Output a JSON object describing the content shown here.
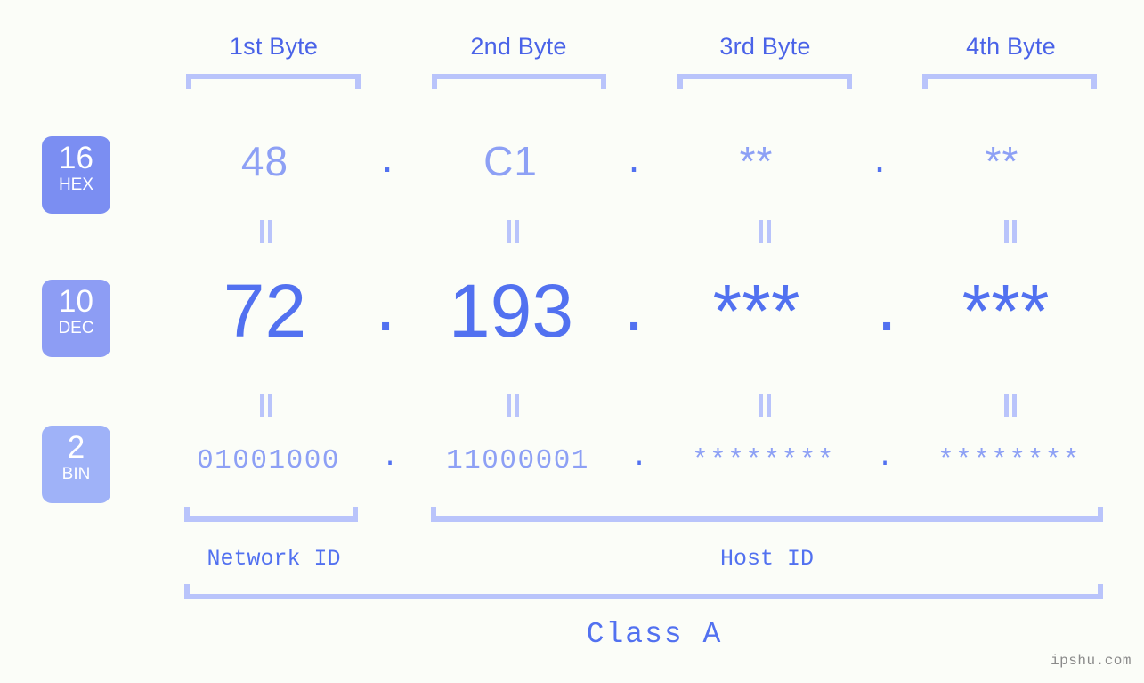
{
  "watermark": "ipshu.com",
  "colors": {
    "background": "#fbfdf8",
    "strong": "#5271f0",
    "mid": "#8da0f5",
    "light": "#b9c4fb",
    "header_text": "#4a63e8",
    "badge_hex": "#7b8ef2",
    "badge_dec": "#8d9df4",
    "badge_bin": "#9fb2f8",
    "watermark": "#8a8a8a"
  },
  "byte_headers": [
    {
      "label": "1st Byte"
    },
    {
      "label": "2nd Byte"
    },
    {
      "label": "3rd Byte"
    },
    {
      "label": "4th Byte"
    }
  ],
  "bases": [
    {
      "number": "16",
      "name": "HEX"
    },
    {
      "number": "10",
      "name": "DEC"
    },
    {
      "number": "2",
      "name": "BIN"
    }
  ],
  "rows": {
    "hex": {
      "base_number": "16",
      "base_name": "HEX",
      "values": [
        "48",
        "C1",
        "**",
        "**"
      ],
      "separators": [
        ".",
        ".",
        "."
      ]
    },
    "dec": {
      "base_number": "10",
      "base_name": "DEC",
      "values": [
        "72",
        "193",
        "***",
        "***"
      ],
      "separators": [
        ".",
        ".",
        "."
      ]
    },
    "bin": {
      "base_number": "2",
      "base_name": "BIN",
      "values": [
        "01001000",
        "11000001",
        "********",
        "********"
      ],
      "separators": [
        ".",
        ".",
        "."
      ]
    }
  },
  "equals_marks": {
    "hex_to_dec": [
      "||",
      "||",
      "||",
      "||"
    ],
    "dec_to_bin": [
      "||",
      "||",
      "||",
      "||"
    ]
  },
  "id_sections": [
    {
      "label": "Network ID"
    },
    {
      "label": "Host ID"
    }
  ],
  "class_section": {
    "label": "Class A"
  }
}
